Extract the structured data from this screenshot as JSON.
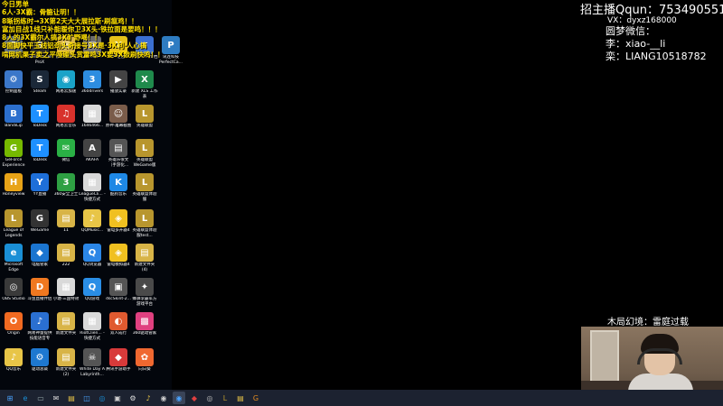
{
  "chat": [
    "今日男单",
    "6人·3X霸：骨骼让明！！",
    "8晰拐练时→3X第2天大大展拉斯·刷瘟鸡！！",
    "富加目战1线只补能暖你卫3X头·铁拉面是要鸣！！！",
    "8人的3X霸尔人搞3X旷野喝！！",
    "8面脚快平玉线铝劲头奇接号3X是·3X利·人心搞",
    "啃网机渠子卖之平哑碰头赏雷鸣3X要3X鼓刷快鸣！！"
  ],
  "icons": [
    {
      "label": "回收站",
      "color": "#5b6b7d",
      "glyph": "♻"
    },
    {
      "label": "Samplitude ProX",
      "color": "#2b2b2b",
      "glyph": "S"
    },
    {
      "label": "新建文件夹",
      "color": "#d8b447",
      "glyph": "▤"
    },
    {
      "label": "22d154...",
      "color": "#6c6c6c",
      "glyph": "▣"
    },
    {
      "label": "YY语音",
      "color": "#e6c21a",
      "glyph": "Y"
    },
    {
      "label": "新建 RTF 文档",
      "color": "#3b6fd1",
      "glyph": "≡"
    },
    {
      "label": "讯连科技 PerfectCa...",
      "color": "#2e7cc2",
      "glyph": "P"
    },
    {
      "label": "控制面板",
      "color": "#3b77c9",
      "glyph": "⚙"
    },
    {
      "label": "Steam",
      "color": "#1b2838",
      "glyph": "S"
    },
    {
      "label": "网易云加速",
      "color": "#1aa3c8",
      "glyph": "◉"
    },
    {
      "label": "360drivers",
      "color": "#2d8de0",
      "glyph": "3"
    },
    {
      "label": "播放实录",
      "color": "#444",
      "glyph": "▶"
    },
    {
      "label": "新建 XLS 工作表",
      "color": "#1f8a4c",
      "glyph": "X"
    },
    {
      "label": "BandiLip",
      "color": "#2c6fcd",
      "glyph": "B"
    },
    {
      "label": "ToDesk",
      "color": "#1e90ff",
      "glyph": "T"
    },
    {
      "label": "网易云音乐",
      "color": "#d8322c",
      "glyph": "♫"
    },
    {
      "label": "1646466...",
      "color": "#d9d9d9",
      "glyph": "▦"
    },
    {
      "label": "原神·屠幕截图",
      "color": "#7a5c4a",
      "glyph": "☺"
    },
    {
      "label": "英雄联盟",
      "color": "#b8962e",
      "glyph": "L"
    },
    {
      "label": "GeForce Experience",
      "color": "#76b900",
      "glyph": "G"
    },
    {
      "label": "ToDesk",
      "color": "#1e90ff",
      "glyph": "T"
    },
    {
      "label": "微信",
      "color": "#2ab045",
      "glyph": "✉"
    },
    {
      "label": "AKAFA",
      "color": "#444",
      "glyph": "A"
    },
    {
      "label": "英雄乐很文（手游化...",
      "color": "#555",
      "glyph": "▤"
    },
    {
      "label": "英雄联盟 WeGame版",
      "color": "#b8962e",
      "glyph": "L"
    },
    {
      "label": "Honeyview",
      "color": "#e8a317",
      "glyph": "H"
    },
    {
      "label": "YY直播",
      "color": "#1e6fd9",
      "glyph": "Y"
    },
    {
      "label": "360安全卫士",
      "color": "#2ea043",
      "glyph": "3"
    },
    {
      "label": "LeagueCli... - 快捷方式",
      "color": "#d9d9d9",
      "glyph": "▦"
    },
    {
      "label": "酷狗音乐",
      "color": "#1e88e5",
      "glyph": "K"
    },
    {
      "label": "英雄联盟体验服",
      "color": "#b8962e",
      "glyph": "L"
    },
    {
      "label": "League of Legends",
      "color": "#b8962e",
      "glyph": "L"
    },
    {
      "label": "WeGame",
      "color": "#333",
      "glyph": "G"
    },
    {
      "label": "11",
      "color": "#d8b447",
      "glyph": "▤"
    },
    {
      "label": "QQMusic...",
      "color": "#e8c547",
      "glyph": "♪"
    },
    {
      "label": "雷电多开器4",
      "color": "#f0c020",
      "glyph": "◈"
    },
    {
      "label": "英雄联盟体验服test...",
      "color": "#b8962e",
      "glyph": "L"
    },
    {
      "label": "Microsoft Edge",
      "color": "#1a8fd6",
      "glyph": "e"
    },
    {
      "label": "电脑管家",
      "color": "#1b75d0",
      "glyph": "◆"
    },
    {
      "label": "222",
      "color": "#d8b447",
      "glyph": "▤"
    },
    {
      "label": "QQ浏览器",
      "color": "#2b86e6",
      "glyph": "Q"
    },
    {
      "label": "雷电模拟器4",
      "color": "#f0c020",
      "glyph": "◈"
    },
    {
      "label": "新建文件夹 (4)",
      "color": "#d8b447",
      "glyph": "▤"
    },
    {
      "label": "OBS Studio",
      "color": "#3a3a3a",
      "glyph": "◎"
    },
    {
      "label": "斗鱼直播伴侣",
      "color": "#f07820",
      "glyph": "D"
    },
    {
      "label": "小塘·三国特效",
      "color": "#d9d9d9",
      "glyph": "▦"
    },
    {
      "label": "QQ游戏",
      "color": "#2a8ee6",
      "glyph": "Q"
    },
    {
      "label": "dscSkint-2...",
      "color": "#555",
      "glyph": "▣"
    },
    {
      "label": "蜂驿李霸军方游戏平台",
      "color": "#4a4a4a",
      "glyph": "✦"
    },
    {
      "label": "Origin",
      "color": "#f26a21",
      "glyph": "O"
    },
    {
      "label": "网易神量提供技能语音专",
      "color": "#2a6fd1",
      "glyph": "♪"
    },
    {
      "label": "新建文件夹",
      "color": "#d8b447",
      "glyph": "▤"
    },
    {
      "label": "RiotClien... - 快捷方式",
      "color": "#d9d9d9",
      "glyph": "▦"
    },
    {
      "label": "双人成行",
      "color": "#e05a30",
      "glyph": "◐"
    },
    {
      "label": "360驱动管家",
      "color": "#e04080",
      "glyph": "▩"
    },
    {
      "label": "QQ音乐",
      "color": "#e8c547",
      "glyph": "♪"
    },
    {
      "label": "驱动总裁",
      "color": "#1e78d0",
      "glyph": "⚙"
    },
    {
      "label": "新建文件夹 (2)",
      "color": "#d8b447",
      "glyph": "▤"
    },
    {
      "label": "White Day A Labyrinth...",
      "color": "#555",
      "glyph": "☠"
    },
    {
      "label": "腾讯手游助手",
      "color": "#d83a3a",
      "glyph": "◆"
    },
    {
      "label": "向日葵",
      "color": "#f06830",
      "glyph": "✿"
    }
  ],
  "info": {
    "qq": "招主播Qqun：753490551",
    "vx": "VX：dyxz168000",
    "dream": "圆梦微信：",
    "li": "李：xiao-__li",
    "li2": "栾：LIANG10518782"
  },
  "caption": "木局幻境：雷庭过载",
  "taskbar": [
    {
      "name": "start-icon",
      "glyph": "⊞",
      "color": "#4aa3ff"
    },
    {
      "name": "edge-icon",
      "glyph": "e",
      "color": "#1a8fd6"
    },
    {
      "name": "task-view-icon",
      "glyph": "▭",
      "color": "#9aa"
    },
    {
      "name": "mail-icon",
      "glyph": "✉",
      "color": "#ddd"
    },
    {
      "name": "explorer-icon",
      "glyph": "▤",
      "color": "#e8c547"
    },
    {
      "name": "store-icon",
      "glyph": "◫",
      "color": "#4aa3ff"
    },
    {
      "name": "browser-icon",
      "glyph": "◎",
      "color": "#1a8fd6"
    },
    {
      "name": "terminal-icon",
      "glyph": "▣",
      "color": "#ccc"
    },
    {
      "name": "gpu-icon",
      "glyph": "⚙",
      "color": "#ddd"
    },
    {
      "name": "music-icon",
      "glyph": "♪",
      "color": "#e8c547"
    },
    {
      "name": "steam-icon",
      "glyph": "◉",
      "color": "#ccc"
    },
    {
      "name": "yy-icon",
      "glyph": "◉",
      "color": "#4aa3ff"
    },
    {
      "name": "red-app-icon",
      "glyph": "◆",
      "color": "#e04040"
    },
    {
      "name": "obs-icon",
      "glyph": "◎",
      "color": "#bbb"
    },
    {
      "name": "lol-icon",
      "glyph": "L",
      "color": "#b8962e"
    },
    {
      "name": "folder-icon",
      "glyph": "▤",
      "color": "#e8c547"
    },
    {
      "name": "g-app-icon",
      "glyph": "G",
      "color": "#e08a20"
    }
  ]
}
